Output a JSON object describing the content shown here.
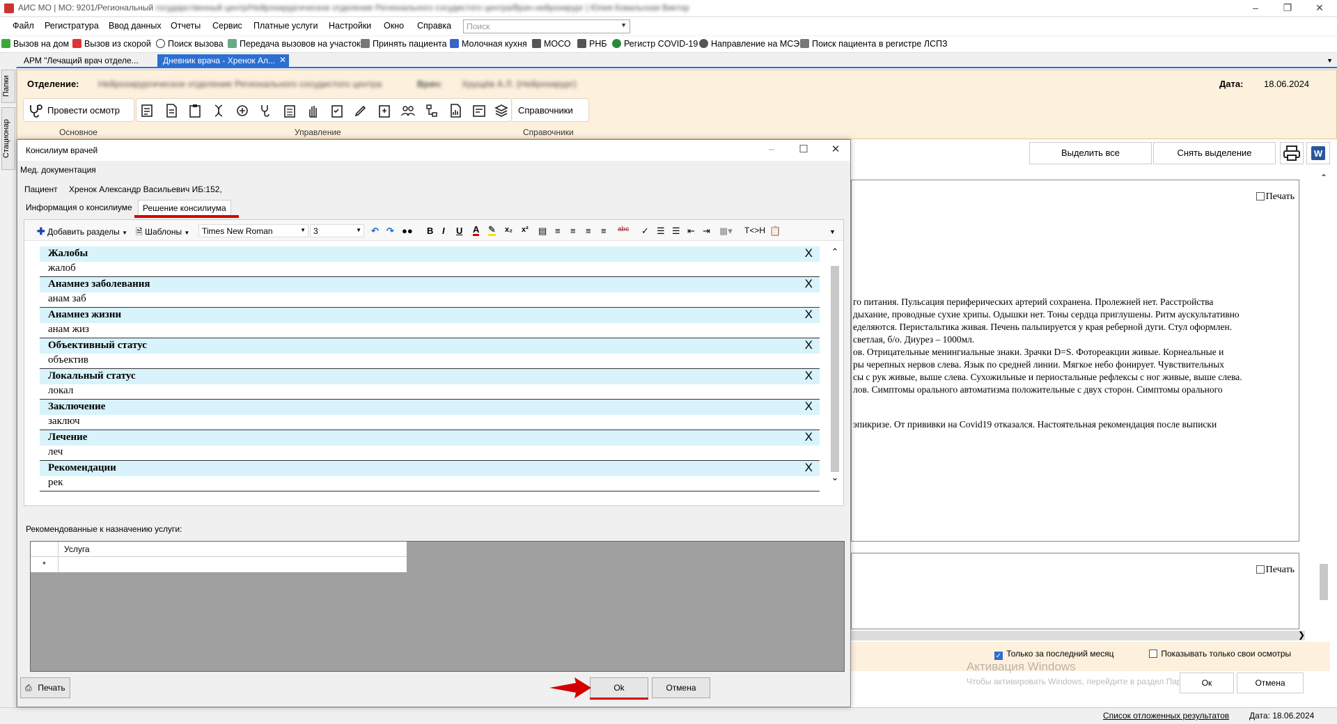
{
  "window": {
    "title_visible": "АИС МО | МО: 9201/Региональный",
    "title_blurred": "государственный центр/Нейрохирургическое отделение Регионального сосудистого центра/Врач-нейрохирург | Юлия Ковальская Виктор"
  },
  "menu": {
    "items": [
      "Файл",
      "Регистратура",
      "Ввод данных",
      "Отчеты",
      "Сервис",
      "Платные услуги",
      "Настройки",
      "Окно",
      "Справка"
    ],
    "search_placeholder": "Поиск"
  },
  "quickbar": {
    "items": [
      "Вызов на дом",
      "Вызов из скорой",
      "Поиск вызова",
      "Передача вызовов на участок",
      "Принять пациента",
      "Молочная кухня",
      "МОСО",
      "РНБ",
      "Регистр COVID-19",
      "Направление на МСЭ",
      "Поиск пациента в регистре ЛСПЗ"
    ]
  },
  "left_tabs": [
    "Папки",
    "Стационар"
  ],
  "doc_tabs": [
    {
      "label": "АРМ \"Лечащий врач отделе...",
      "active": false
    },
    {
      "label": "Дневник врача - Хренок Ал...",
      "active": true
    }
  ],
  "header": {
    "department_label": "Отделение:",
    "department_value": "Нейрохирургическое отделение Регионального сосудистого центра",
    "doctor_label": "Врач:",
    "doctor_value": "Хрущёв А.Л. (Нейрохирург)",
    "date_label": "Дата:",
    "date_value": "18.06.2024"
  },
  "ribbon": {
    "exam_button": "Провести осмотр",
    "refs_button": "Справочники",
    "groups": [
      "Основное",
      "Управление",
      "Справочники"
    ]
  },
  "right_panel": {
    "select_all": "Выделить все",
    "deselect": "Снять выделение",
    "print_label": "Печать",
    "text_lines": [
      "го питания. Пульсация периферических артерий сохранена. Пролежней нет. Расстройства",
      "дыхание, проводные сухие хрипы. Одышки нет. Тоны сердца приглушены. Ритм аускультативно",
      "еделяются. Перистальтика живая. Печень пальпируется у края реберной дуги. Стул оформлен.",
      "светлая, б/о. Диурез – 1000мл.",
      "ов. Отрицательные менингиальные знаки. Зрачки D=S. Фотореакции живые. Корнеальные и",
      "ры черепных нервов слева. Язык по средней линии. Мягкое небо фонирует. Чувствительных",
      "сы с рук живые, выше слева. Сухожильные и периостальные рефлексы с ног живые, выше слева.",
      "лов. Симптомы орального автоматизма положительные с двух сторон. Симптомы орального"
    ],
    "text_line2": "эпикризе. От прививки на Covid19 отказался. Настоятельная рекомендация после выписки",
    "last_month_label": "Только за последний месяц",
    "only_mine_label": "Показывать только свои осмотры",
    "ok_label": "Ок",
    "cancel_label": "Отмена",
    "windows_activation": "Активация Windows",
    "windows_activation_sub": "Чтобы активировать Windows, перейдите в раздел Параметры."
  },
  "dialog": {
    "title": "Консилиум врачей",
    "subtitle": "Мед. документация",
    "patient_label": "Пациент",
    "patient_value": "Хренок Александр Васильевич ИБ:152,",
    "tabs": [
      "Информация о консилиуме",
      "Решение консилиума"
    ],
    "toolbar": {
      "add_sections": "Добавить разделы",
      "templates": "Шаблоны",
      "font": "Times New Roman",
      "size": "3",
      "tc": "T<>H"
    },
    "sections": [
      {
        "title": "Жалобы",
        "body": "жалоб"
      },
      {
        "title": "Анамнез заболевания",
        "body": "анам заб"
      },
      {
        "title": "Анамнез жизни",
        "body": "анам жиз"
      },
      {
        "title": "Объективный статус",
        "body": "объектив"
      },
      {
        "title": "Локальный статус",
        "body": "локал"
      },
      {
        "title": "Заключение",
        "body": "заключ"
      },
      {
        "title": "Лечение",
        "body": "леч"
      },
      {
        "title": "Рекомендации",
        "body": "рек"
      }
    ],
    "close_mark": "X",
    "services_label": "Рекомендованные к назначению услуги:",
    "grid_header": "Услуга",
    "grid_row_marker": "*",
    "print_button": "Печать",
    "ok_button": "Ok",
    "cancel_button": "Отмена"
  },
  "statusbar": {
    "deferred": "Список отложенных результатов",
    "date": "Дата: 18.06.2024"
  },
  "colors": {
    "accent": "#2c6fd1",
    "header_bg": "#fdf0dc",
    "section_bg": "#d8f3fb",
    "annotation_red": "#d40000"
  }
}
